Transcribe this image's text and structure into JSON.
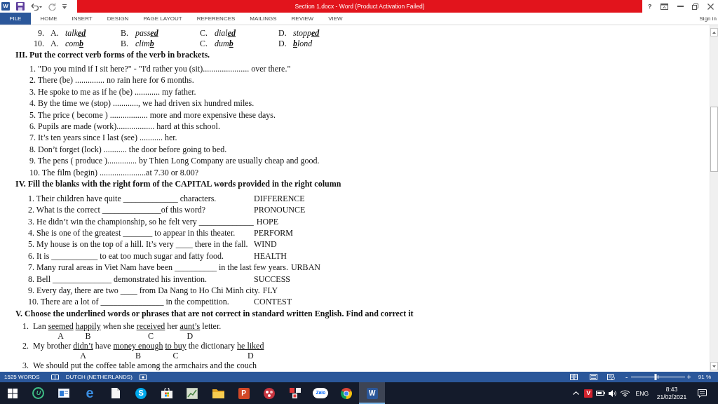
{
  "window": {
    "app_glyph": "W",
    "title": "Section 1.docx - Word (Product Activation Failed)",
    "help": "?"
  },
  "ribbon": {
    "file_tab": "FILE",
    "tabs": [
      {
        "label": "HOME",
        "selected": false
      },
      {
        "label": "INSERT",
        "selected": false
      },
      {
        "label": "DESIGN",
        "selected": false
      },
      {
        "label": "PAGE LAYOUT",
        "selected": false
      },
      {
        "label": "REFERENCES",
        "selected": false
      },
      {
        "label": "MAILINGS",
        "selected": false
      },
      {
        "label": "REVIEW",
        "selected": false
      },
      {
        "label": "VIEW",
        "selected": false
      }
    ],
    "sign_in": "Sign in"
  },
  "document": {
    "choice_rows": [
      {
        "number": "9.",
        "options": [
          {
            "letter": "A.",
            "parts": [
              {
                "text": "talk",
                "underlined": false
              },
              {
                "text": "ed",
                "underlined": true
              }
            ]
          },
          {
            "letter": "B.",
            "parts": [
              {
                "text": "pass",
                "underlined": false
              },
              {
                "text": "ed",
                "underlined": true
              }
            ]
          },
          {
            "letter": "C.",
            "parts": [
              {
                "text": "dial",
                "underlined": false
              },
              {
                "text": "ed",
                "underlined": true
              }
            ]
          },
          {
            "letter": "D.",
            "parts": [
              {
                "text": "stopp",
                "underlined": false
              },
              {
                "text": "ed",
                "underlined": true
              }
            ]
          }
        ]
      },
      {
        "number": "10.",
        "options": [
          {
            "letter": "A.",
            "parts": [
              {
                "text": "com",
                "underlined": false
              },
              {
                "text": "b",
                "underlined": true
              }
            ]
          },
          {
            "letter": "B.",
            "parts": [
              {
                "text": "clim",
                "underlined": false
              },
              {
                "text": "b",
                "underlined": true
              }
            ]
          },
          {
            "letter": "C.",
            "parts": [
              {
                "text": "dum",
                "underlined": false
              },
              {
                "text": "b",
                "underlined": true
              }
            ]
          },
          {
            "letter": "D.",
            "parts": [
              {
                "text": "b",
                "underlined": true
              },
              {
                "text": "lond",
                "underlined": false
              }
            ]
          }
        ]
      }
    ],
    "sections": [
      {
        "kind": "lines",
        "heading": "III. Put the correct verb forms of the verb in brackets.",
        "items": [
          {
            "text": "1. \"Do you mind if I sit here?\" - \"I'd rather you (sit)...................... over there.\""
          },
          {
            "text": "2. There (be) .............. no rain here for 6 months."
          },
          {
            "text": "3. He spoke to me as if he (be) ............ my father."
          },
          {
            "text": "4. By the time we (stop) ............, we had driven six hundred miles."
          },
          {
            "text": "5. The price ( become ) .................. more and more expensive these days."
          },
          {
            "text": "6. Pupils are made (work).................. hard at this school."
          },
          {
            "text": "7. It’s ten years since I last (see) ........... her."
          },
          {
            "text": "8. Don’t forget (lock) ........... the door before going to bed."
          },
          {
            "text": "9. The pens ( produce ).............. by Thien Long Company are usually cheap and good."
          },
          {
            "text": "10. The film (begin) ......................at 7.30 or 8.00?"
          }
        ]
      },
      {
        "kind": "words",
        "heading": "IV. Fill the blanks with the right form of the CAPITAL words provided in the right column",
        "items": [
          {
            "text": "1. Their children have quite _____________ characters.",
            "word": "DIFFERENCE"
          },
          {
            "text": "2. What is the correct ______________of this word?",
            "word": "PRONOUNCE"
          },
          {
            "text": "3. He didn’t win the championship, so he felt very _____________",
            "word": "HOPE"
          },
          {
            "text": "4. She is one of the greatest _______ to appear in this theater.",
            "word": "PERFORM"
          },
          {
            "text": "5. My house is on the top of a hill. It’s very ____ there in the fall.",
            "word": "WIND"
          },
          {
            "text": "6. It is ___________ to eat too much sugar and fatty food.",
            "word": "HEALTH"
          },
          {
            "text": "7. Many rural areas in Viet Nam have been __________ in the last few years.",
            "word": "URBAN"
          },
          {
            "text": "8. Bell ______________ demonstrated his invention.",
            "word": "SUCCESS"
          },
          {
            "text": "9. Every day, there are two ____ from Da Nang to Ho Chi Minh city.",
            "word": "FLY"
          },
          {
            "text": "10. There are a lot of _______________ in the competition.",
            "word": "CONTEST"
          }
        ]
      },
      {
        "kind": "underlined",
        "heading": "V. Choose the underlined words or phrases that are not correct in standard written English. Find and correct it",
        "items": [
          {
            "number": "1.",
            "parts": [
              {
                "text": "Lan",
                "underlined": false
              },
              {
                "text": "seemed",
                "underlined": true,
                "letter": "A"
              },
              {
                "text": "happily",
                "underlined": true,
                "letter": "B"
              },
              {
                "text": "when she",
                "underlined": false
              },
              {
                "text": "received",
                "underlined": true,
                "letter": "C"
              },
              {
                "text": "her",
                "underlined": false
              },
              {
                "text": "aunt’s",
                "underlined": true,
                "letter": "D"
              },
              {
                "text": "letter.",
                "underlined": false
              }
            ]
          },
          {
            "number": "2.",
            "parts": [
              {
                "text": "My brother",
                "underlined": false
              },
              {
                "text": "didn’t",
                "underlined": true,
                "letter": "A"
              },
              {
                "text": "have",
                "underlined": false
              },
              {
                "text": "money enough",
                "underlined": true,
                "letter": "B"
              },
              {
                "text": "to buy",
                "underlined": true,
                "letter": "C"
              },
              {
                "text": "the dictionary",
                "underlined": false
              },
              {
                "text": "he liked",
                "underlined": true,
                "letter": "D"
              }
            ]
          },
          {
            "number": "3.",
            "parts": [
              {
                "text": "We should put the coffee table among the armchairs and the couch",
                "underlined": false
              }
            ]
          }
        ]
      }
    ]
  },
  "status_bar": {
    "words": "1525 WORDS",
    "language": "DUTCH (NETHERLANDS)",
    "zoom": {
      "minus": "-",
      "plus": "+",
      "level": 0.46,
      "reading": "91 %"
    }
  },
  "taskbar": {
    "apps": [
      {
        "kind": "start",
        "active": false
      },
      {
        "kind": "u-app",
        "glyph": "U",
        "active": false
      },
      {
        "kind": "window-app",
        "active": false
      },
      {
        "kind": "edge",
        "glyph": "e",
        "active": false
      },
      {
        "kind": "file",
        "active": false
      },
      {
        "kind": "skype",
        "glyph": "S",
        "active": false
      },
      {
        "kind": "store",
        "active": false
      },
      {
        "kind": "chart",
        "active": false
      },
      {
        "kind": "folder",
        "active": false
      },
      {
        "kind": "powerpoint",
        "glyph": "P",
        "active": false
      },
      {
        "kind": "dots",
        "active": false
      },
      {
        "kind": "tiles",
        "active": false
      },
      {
        "kind": "zalo",
        "glyph": "Zalo",
        "active": false
      },
      {
        "kind": "chrome",
        "active": false
      },
      {
        "kind": "word",
        "glyph": "W",
        "active": true
      }
    ],
    "tray": [
      {
        "kind": "chevron"
      },
      {
        "kind": "antivirus",
        "glyph": "V"
      },
      {
        "kind": "battery"
      },
      {
        "kind": "volume"
      },
      {
        "kind": "wifi"
      }
    ],
    "language": "ENG",
    "time": "8:43",
    "date": "21/02/2021"
  }
}
